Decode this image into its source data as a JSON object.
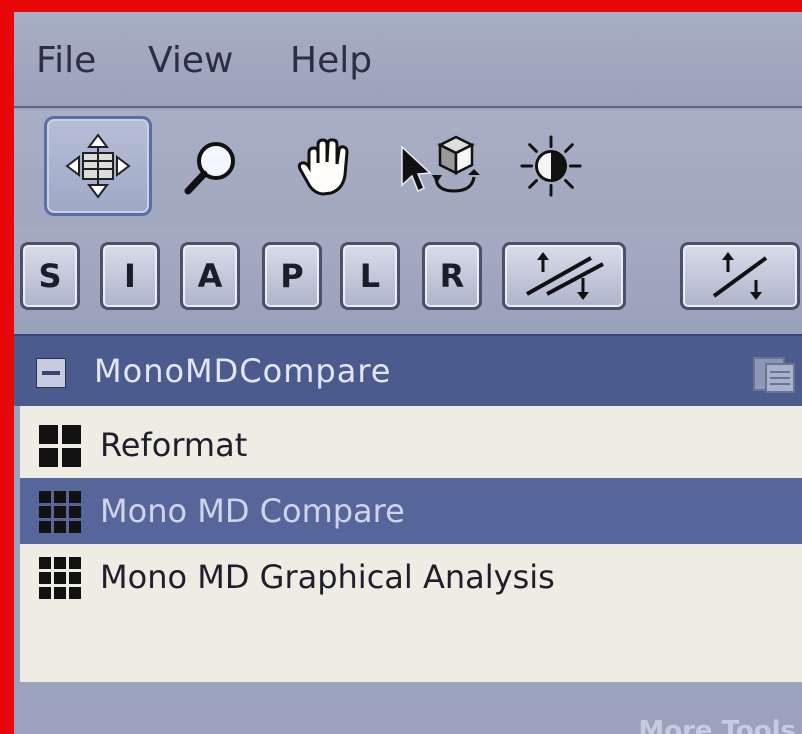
{
  "menu": {
    "file": "File",
    "view": "View",
    "help": "Help"
  },
  "toolbar": {
    "tools": [
      "move-icon",
      "zoom-icon",
      "pan-hand-icon",
      "3d-rotate-icon",
      "window-level-icon"
    ],
    "active": "move-icon"
  },
  "view_buttons": {
    "s": "S",
    "i": "I",
    "a": "A",
    "p": "P",
    "l": "L",
    "r": "R",
    "extra": [
      "slice-plane-down-icon",
      "slice-plane-up-icon"
    ]
  },
  "panel": {
    "title": "MonoMDCompare",
    "items": [
      {
        "label": "Reformat",
        "icon": "grid-2x2-icon",
        "selected": false
      },
      {
        "label": "Mono MD Compare",
        "icon": "grid-3x3-icon",
        "selected": true
      },
      {
        "label": "Mono MD Graphical Analysis",
        "icon": "grid-3x3-icon",
        "selected": false
      }
    ]
  },
  "footer": {
    "more_tools": "More Tools"
  },
  "colors": {
    "border": "#e8080a",
    "panel_header": "#4c5b8e",
    "selected_row": "#56659a",
    "list_bg": "#efece4"
  }
}
